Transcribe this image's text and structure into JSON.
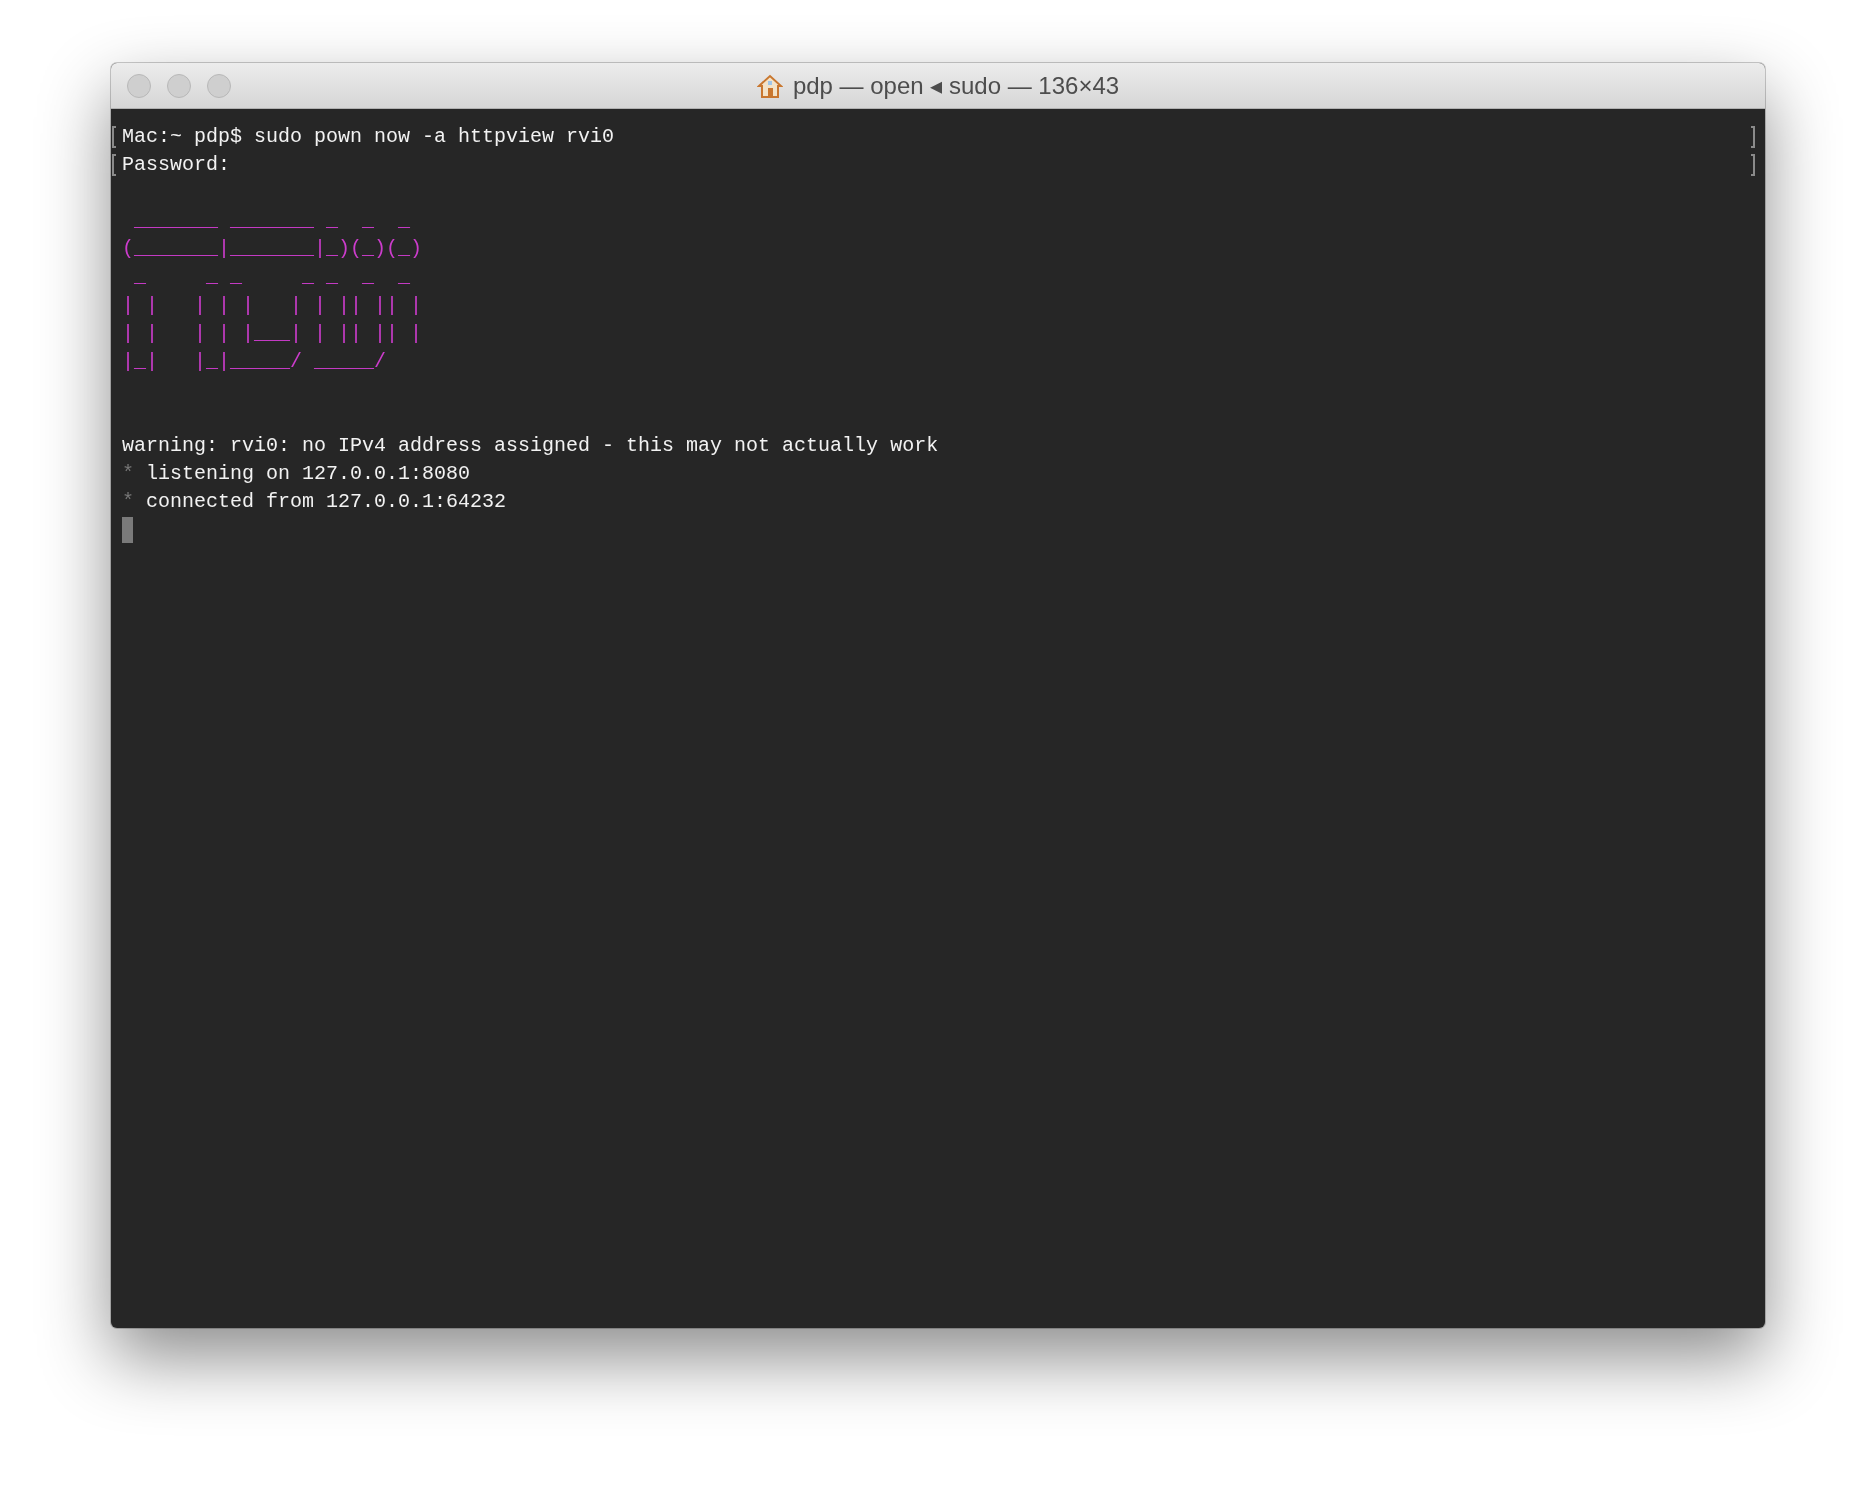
{
  "window": {
    "title": "pdp — open ◂ sudo — 136×43"
  },
  "terminal": {
    "lines": [
      {
        "kind": "text",
        "text": "Mac:~ pdp$ sudo pown now -a httpview rvi0",
        "marked": true
      },
      {
        "kind": "text",
        "text": "Password:",
        "marked": true
      },
      {
        "kind": "blank"
      },
      {
        "kind": "art",
        "text": " _______ _______ _  _  _"
      },
      {
        "kind": "art",
        "text": "(_______|_______|_)(_)(_)"
      },
      {
        "kind": "art",
        "text": " _     _ _     _ _  _  _"
      },
      {
        "kind": "art",
        "text": "| |   | | |   | | || || |"
      },
      {
        "kind": "art",
        "text": "| |   | | |___| | || || |"
      },
      {
        "kind": "art",
        "text": "|_|   |_|_____/ _____/"
      },
      {
        "kind": "blank"
      },
      {
        "kind": "blank"
      },
      {
        "kind": "text",
        "text": "warning: rvi0: no IPv4 address assigned - this may not actually work",
        "marked": false
      },
      {
        "kind": "bullet",
        "bullet": "*",
        "text": "listening on 127.0.0.1:8080"
      },
      {
        "kind": "bullet",
        "bullet": "*",
        "text": "connected from 127.0.0.1:64232"
      },
      {
        "kind": "cursor"
      }
    ]
  }
}
